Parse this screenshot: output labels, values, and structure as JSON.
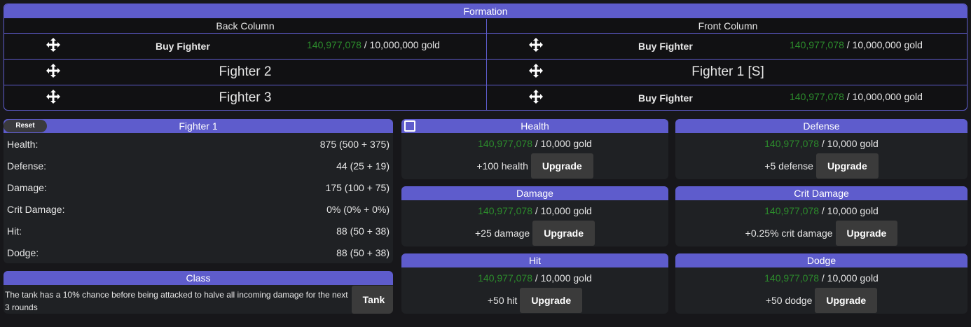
{
  "formation": {
    "title": "Formation",
    "back": {
      "title": "Back Column",
      "slots": [
        {
          "buy_label": "Buy Fighter",
          "owned": "140,977,078",
          "cost": " / 10,000,000 gold"
        },
        {
          "name": "Fighter 2"
        },
        {
          "name": "Fighter 3"
        }
      ]
    },
    "front": {
      "title": "Front Column",
      "slots": [
        {
          "buy_label": "Buy Fighter",
          "owned": "140,977,078",
          "cost": " / 10,000,000 gold"
        },
        {
          "name": "Fighter 1 [S]"
        },
        {
          "buy_label": "Buy Fighter",
          "owned": "140,977,078",
          "cost": " / 10,000,000 gold"
        }
      ]
    }
  },
  "stats": {
    "reset_label": "Reset",
    "title": "Fighter 1",
    "rows": [
      {
        "label": "Health:",
        "value": "875 (500 + 375)"
      },
      {
        "label": "Defense:",
        "value": "44 (25 + 19)"
      },
      {
        "label": "Damage:",
        "value": "175 (100 + 75)"
      },
      {
        "label": "Crit Damage:",
        "value": "0% (0% + 0%)"
      },
      {
        "label": "Hit:",
        "value": "88 (50 + 38)"
      },
      {
        "label": "Dodge:",
        "value": "88 (50 + 38)"
      }
    ]
  },
  "class": {
    "title": "Class",
    "description": "The tank has a 10% chance before being attacked to halve all incoming damage for the next 3 rounds",
    "button": "Tank"
  },
  "upgrades": {
    "health": {
      "title": "Health",
      "owned": "140,977,078",
      "cost": " / 10,000 gold",
      "increment": "+100 health",
      "button": "Upgrade"
    },
    "defense": {
      "title": "Defense",
      "owned": "140,977,078",
      "cost": " / 10,000 gold",
      "increment": "+5 defense",
      "button": "Upgrade"
    },
    "damage": {
      "title": "Damage",
      "owned": "140,977,078",
      "cost": " / 10,000 gold",
      "increment": "+25 damage",
      "button": "Upgrade"
    },
    "crit": {
      "title": "Crit Damage",
      "owned": "140,977,078",
      "cost": " / 10,000 gold",
      "increment": "+0.25% crit damage",
      "button": "Upgrade"
    },
    "hit": {
      "title": "Hit",
      "owned": "140,977,078",
      "cost": " / 10,000 gold",
      "increment": "+50 hit",
      "button": "Upgrade"
    },
    "dodge": {
      "title": "Dodge",
      "owned": "140,977,078",
      "cost": " / 10,000 gold",
      "increment": "+50 dodge",
      "button": "Upgrade"
    }
  },
  "icons": {
    "move": "move-arrows-icon",
    "checkbox": "checkbox-icon"
  },
  "colors": {
    "accent": "#5e5ccc",
    "gold_owned": "#2c8c2c",
    "background": "#17171a",
    "panel": "#1f2124",
    "button": "#3b3b3b"
  }
}
